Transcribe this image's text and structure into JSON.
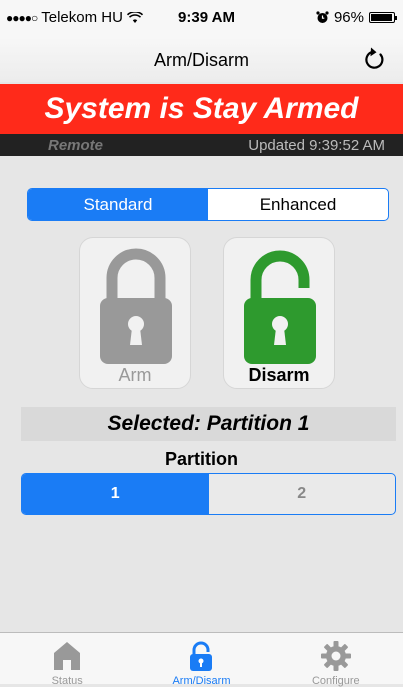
{
  "status_bar": {
    "signal": "●●●●○",
    "carrier": "Telekom HU",
    "wifi_icon": "wifi-icon",
    "time": "9:39 AM",
    "alarm_icon": "alarm-clock-icon",
    "battery": "96%",
    "battery_level": 0.96
  },
  "nav": {
    "title": "Arm/Disarm",
    "refresh_icon": "refresh-icon"
  },
  "banner": {
    "text": "System is Stay Armed",
    "color": "#ff2a1a"
  },
  "substatus": {
    "mode": "Remote",
    "updated": "Updated 9:39:52 AM"
  },
  "mode_segment": {
    "options": [
      "Standard",
      "Enhanced"
    ],
    "selected": "Standard",
    "accent": "#1a7cf5"
  },
  "actions": {
    "arm": {
      "label": "Arm",
      "icon": "lock-closed-icon",
      "enabled": false
    },
    "disarm": {
      "label": "Disarm",
      "icon": "lock-open-icon",
      "enabled": true,
      "color": "#2e9a2e"
    }
  },
  "selection": {
    "text": "Selected: Partition 1"
  },
  "partition": {
    "heading": "Partition",
    "options": [
      "1",
      "2"
    ],
    "selected": "1"
  },
  "tabs": [
    {
      "label": "Status",
      "icon": "house-icon",
      "active": false
    },
    {
      "label": "Arm/Disarm",
      "icon": "lock-icon",
      "active": true
    },
    {
      "label": "Configure",
      "icon": "gear-icon",
      "active": false
    }
  ]
}
